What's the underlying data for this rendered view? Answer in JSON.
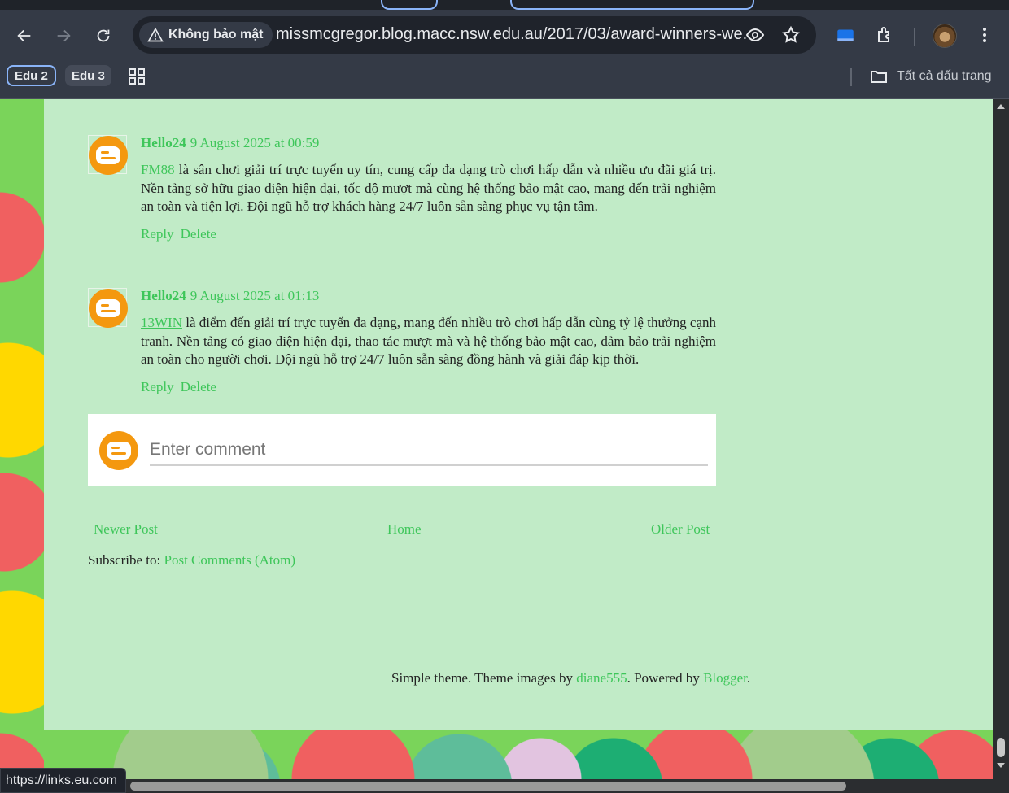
{
  "browser": {
    "security_label": "Không bảo mật",
    "url": "missmcgregor.blog.macc.nsw.edu.au/2017/03/award-winners-we...",
    "bookmarks": [
      {
        "label": "Edu 2"
      },
      {
        "label": "Edu 3"
      }
    ],
    "all_bookmarks_label": "Tất cả dấu trang",
    "status_url": "https://links.eu.com"
  },
  "comments": [
    {
      "author": "Hello24",
      "timestamp": "9 August 2025 at 00:59",
      "link_text": "FM88",
      "body": " là sân chơi giải trí trực tuyến uy tín, cung cấp đa dạng trò chơi hấp dẫn và nhiều ưu đãi giá trị. Nền tảng sở hữu giao diện hiện đại, tốc độ mượt mà cùng hệ thống bảo mật cao, mang đến trải nghiệm an toàn và tiện lợi. Đội ngũ hỗ trợ khách hàng 24/7 luôn sẵn sàng phục vụ tận tâm.",
      "reply_label": "Reply",
      "delete_label": "Delete"
    },
    {
      "author": "Hello24",
      "timestamp": "9 August 2025 at 01:13",
      "link_text": "13WIN",
      "body": " là điểm đến giải trí trực tuyến đa dạng, mang đến nhiều trò chơi hấp dẫn cùng tỷ lệ thưởng cạnh tranh. Nền tảng có giao diện hiện đại, thao tác mượt mà và hệ thống bảo mật cao, đảm bảo trải nghiệm an toàn cho người chơi. Đội ngũ hỗ trợ 24/7 luôn sẵn sàng đồng hành và giải đáp kịp thời.",
      "reply_label": "Reply",
      "delete_label": "Delete"
    }
  ],
  "comment_form": {
    "placeholder": "Enter comment"
  },
  "pager": {
    "newer": "Newer Post",
    "home": "Home",
    "older": "Older Post"
  },
  "subscribe": {
    "label": "Subscribe to: ",
    "link": "Post Comments (Atom)"
  },
  "footer": {
    "text_1": "Simple theme. Theme images by ",
    "link_1": "diane555",
    "text_2": ". Powered by ",
    "link_2": "Blogger",
    "text_3": "."
  },
  "colors": {
    "link": "#3ec65a",
    "content_bg": "#c1ebc7",
    "chrome_bg": "#343a46"
  }
}
